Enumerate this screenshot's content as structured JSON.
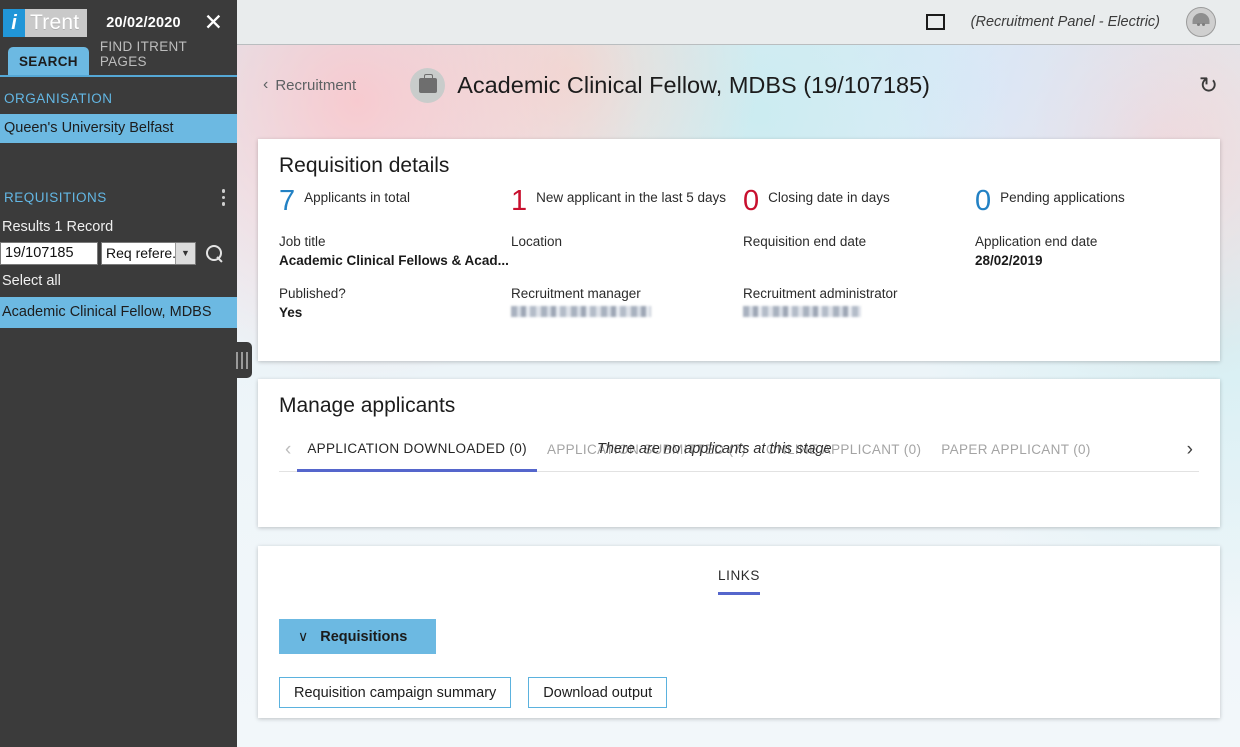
{
  "sidebar": {
    "logo_i": "i",
    "logo_word": "Trent",
    "date": "20/02/2020",
    "close_icon": "✕",
    "tabs": [
      {
        "label": "SEARCH",
        "active": true
      },
      {
        "label": "FIND ITRENT PAGES",
        "active": false
      }
    ],
    "organisation": {
      "section_label": "ORGANISATION",
      "selected": "Queen's University Belfast"
    },
    "requisitions": {
      "section_label": "REQUISITIONS",
      "results_text": "Results 1 Record",
      "search_value": "19/107185",
      "search_placeholder": "19/107185",
      "filter_selected": "Req refere...",
      "filter_options": [
        "Req refere..."
      ],
      "select_all_label": "Select all",
      "records": [
        "Academic Clinical Fellow, MDBS"
      ]
    }
  },
  "topbar": {
    "window_icon": "window-icon",
    "panel_label": "(Recruitment Panel - Electric)",
    "avatar": "user-avatar"
  },
  "header": {
    "breadcrumb_chevron": "‹",
    "breadcrumb": "Recruitment",
    "title": "Academic Clinical Fellow, MDBS (19/107185)",
    "refresh_icon": "↻"
  },
  "requisition_details": {
    "card_title": "Requisition details",
    "stats": [
      {
        "value": "7",
        "label": "Applicants in total",
        "color": "#2281c4"
      },
      {
        "value": "1",
        "label": "New applicant in the last 5 days",
        "color": "#c8102e"
      },
      {
        "value": "0",
        "label": "Closing date in days",
        "color": "#c8102e"
      },
      {
        "value": "0",
        "label": "Pending applications",
        "color": "#2281c4"
      }
    ],
    "fields_row1": [
      {
        "label": "Job title",
        "value": "Academic Clinical Fellows & Acad...",
        "redacted": false
      },
      {
        "label": "Location",
        "value": "",
        "redacted": false
      },
      {
        "label": "Requisition end date",
        "value": "",
        "redacted": false
      },
      {
        "label": "Application end date",
        "value": "28/02/2019",
        "redacted": false
      }
    ],
    "fields_row2": [
      {
        "label": "Published?",
        "value": "Yes",
        "redacted": false
      },
      {
        "label": "Recruitment manager",
        "value": "",
        "redacted": true
      },
      {
        "label": "Recruitment administrator",
        "value": "",
        "redacted": true
      }
    ]
  },
  "manage_applicants": {
    "card_title": "Manage applicants",
    "prev_arrow": "‹",
    "next_arrow": "›",
    "tabs": [
      {
        "label": "APPLICATION DOWNLOADED (0)",
        "active": true
      },
      {
        "label": "APPLICATION SUBMITTED (7)",
        "active": false
      },
      {
        "label": "ONLINE APPLICANT (0)",
        "active": false
      },
      {
        "label": "PAPER APPLICANT (0)",
        "active": false
      }
    ],
    "empty_message": "There are no applicants at this stage"
  },
  "links": {
    "tab_label": "LINKS",
    "primary_button": {
      "label": "Requisitions",
      "chevron": "∨"
    },
    "buttons": [
      "Requisition campaign summary",
      "Download output"
    ]
  }
}
